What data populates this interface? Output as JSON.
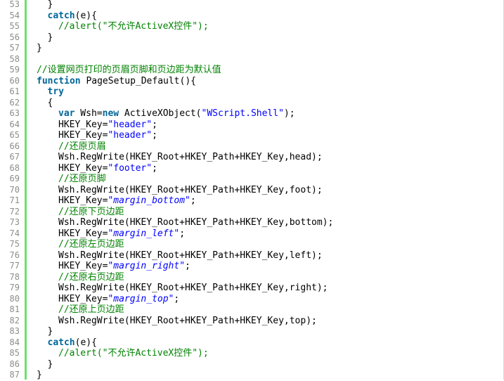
{
  "colors": {
    "keyword": "#006699",
    "string": "#0000ff",
    "comment": "#008200",
    "line_number": "#8c8c8c",
    "gutter_bar": "#6ce26c"
  },
  "code_lines": [
    {
      "num": "53",
      "indent": 1,
      "parts": [
        {
          "t": "}",
          "c": ""
        }
      ]
    },
    {
      "num": "54",
      "indent": 1,
      "parts": [
        {
          "t": "catch",
          "c": "kw"
        },
        {
          "t": "(e){",
          "c": ""
        }
      ]
    },
    {
      "num": "55",
      "indent": 2,
      "parts": [
        {
          "t": "//alert(\"不允许ActiveX控件\");",
          "c": "cm"
        }
      ]
    },
    {
      "num": "56",
      "indent": 1,
      "parts": [
        {
          "t": "}",
          "c": ""
        }
      ]
    },
    {
      "num": "57",
      "indent": 0,
      "parts": [
        {
          "t": "}",
          "c": ""
        }
      ]
    },
    {
      "num": "58",
      "indent": 0,
      "parts": []
    },
    {
      "num": "59",
      "indent": 0,
      "parts": [
        {
          "t": "//设置网页打印的页眉页脚和页边距为默认值",
          "c": "cm"
        }
      ]
    },
    {
      "num": "60",
      "indent": 0,
      "parts": [
        {
          "t": "function",
          "c": "kw"
        },
        {
          "t": " PageSetup_Default(){",
          "c": ""
        }
      ]
    },
    {
      "num": "61",
      "indent": 1,
      "parts": [
        {
          "t": "try",
          "c": "kw"
        }
      ]
    },
    {
      "num": "62",
      "indent": 1,
      "parts": [
        {
          "t": "{",
          "c": ""
        }
      ]
    },
    {
      "num": "63",
      "indent": 2,
      "parts": [
        {
          "t": "var",
          "c": "kw"
        },
        {
          "t": " Wsh=",
          "c": ""
        },
        {
          "t": "new",
          "c": "kw"
        },
        {
          "t": " ActiveXObject(",
          "c": ""
        },
        {
          "t": "\"WScript.Shell\"",
          "c": "str"
        },
        {
          "t": ");",
          "c": ""
        }
      ]
    },
    {
      "num": "64",
      "indent": 2,
      "parts": [
        {
          "t": "HKEY_Key=",
          "c": ""
        },
        {
          "t": "\"header\"",
          "c": "str"
        },
        {
          "t": ";",
          "c": ""
        }
      ]
    },
    {
      "num": "65",
      "indent": 2,
      "parts": [
        {
          "t": "HKEY_Key=",
          "c": ""
        },
        {
          "t": "\"header\"",
          "c": "str"
        },
        {
          "t": ";",
          "c": ""
        }
      ]
    },
    {
      "num": "66",
      "indent": 2,
      "parts": [
        {
          "t": "//还原页眉",
          "c": "cm"
        }
      ]
    },
    {
      "num": "67",
      "indent": 2,
      "parts": [
        {
          "t": "Wsh.RegWrite(HKEY_Root+HKEY_Path+HKEY_Key,head);",
          "c": ""
        }
      ]
    },
    {
      "num": "68",
      "indent": 2,
      "parts": [
        {
          "t": "HKEY_Key=",
          "c": ""
        },
        {
          "t": "\"footer\"",
          "c": "str"
        },
        {
          "t": ";",
          "c": ""
        }
      ]
    },
    {
      "num": "69",
      "indent": 2,
      "parts": [
        {
          "t": "//还原页脚",
          "c": "cm"
        }
      ]
    },
    {
      "num": "70",
      "indent": 2,
      "parts": [
        {
          "t": "Wsh.RegWrite(HKEY_Root+HKEY_Path+HKEY_Key,foot);",
          "c": ""
        }
      ]
    },
    {
      "num": "71",
      "indent": 2,
      "parts": [
        {
          "t": "HKEY_Key=",
          "c": ""
        },
        {
          "t": "\"margin_bottom\"",
          "c": "str"
        },
        {
          "t": ";",
          "c": ""
        }
      ]
    },
    {
      "num": "72",
      "indent": 2,
      "parts": [
        {
          "t": "//还原下页边距",
          "c": "cm"
        }
      ]
    },
    {
      "num": "73",
      "indent": 2,
      "parts": [
        {
          "t": "Wsh.RegWrite(HKEY_Root+HKEY_Path+HKEY_Key,bottom);",
          "c": ""
        }
      ]
    },
    {
      "num": "74",
      "indent": 2,
      "parts": [
        {
          "t": "HKEY_Key=",
          "c": ""
        },
        {
          "t": "\"margin_left\"",
          "c": "str"
        },
        {
          "t": ";",
          "c": ""
        }
      ]
    },
    {
      "num": "75",
      "indent": 2,
      "parts": [
        {
          "t": "//还原左页边距",
          "c": "cm"
        }
      ]
    },
    {
      "num": "76",
      "indent": 2,
      "parts": [
        {
          "t": "Wsh.RegWrite(HKEY_Root+HKEY_Path+HKEY_Key,left);",
          "c": ""
        }
      ]
    },
    {
      "num": "77",
      "indent": 2,
      "parts": [
        {
          "t": "HKEY_Key=",
          "c": ""
        },
        {
          "t": "\"margin_right\"",
          "c": "str"
        },
        {
          "t": ";",
          "c": ""
        }
      ]
    },
    {
      "num": "78",
      "indent": 2,
      "parts": [
        {
          "t": "//还原右页边距",
          "c": "cm"
        }
      ]
    },
    {
      "num": "79",
      "indent": 2,
      "parts": [
        {
          "t": "Wsh.RegWrite(HKEY_Root+HKEY_Path+HKEY_Key,right);",
          "c": ""
        }
      ]
    },
    {
      "num": "80",
      "indent": 2,
      "parts": [
        {
          "t": "HKEY_Key=",
          "c": ""
        },
        {
          "t": "\"margin_top\"",
          "c": "str"
        },
        {
          "t": ";",
          "c": ""
        }
      ]
    },
    {
      "num": "81",
      "indent": 2,
      "parts": [
        {
          "t": "//还原上页边距",
          "c": "cm"
        }
      ]
    },
    {
      "num": "82",
      "indent": 2,
      "parts": [
        {
          "t": "Wsh.RegWrite(HKEY_Root+HKEY_Path+HKEY_Key,top);",
          "c": ""
        }
      ]
    },
    {
      "num": "83",
      "indent": 1,
      "parts": [
        {
          "t": "}",
          "c": ""
        }
      ]
    },
    {
      "num": "84",
      "indent": 1,
      "parts": [
        {
          "t": "catch",
          "c": "kw"
        },
        {
          "t": "(e){",
          "c": ""
        }
      ]
    },
    {
      "num": "85",
      "indent": 2,
      "parts": [
        {
          "t": "//alert(\"不允许ActiveX控件\");",
          "c": "cm"
        }
      ]
    },
    {
      "num": "86",
      "indent": 1,
      "parts": [
        {
          "t": "}",
          "c": ""
        }
      ]
    },
    {
      "num": "87",
      "indent": 0,
      "parts": [
        {
          "t": "}",
          "c": ""
        }
      ]
    }
  ]
}
